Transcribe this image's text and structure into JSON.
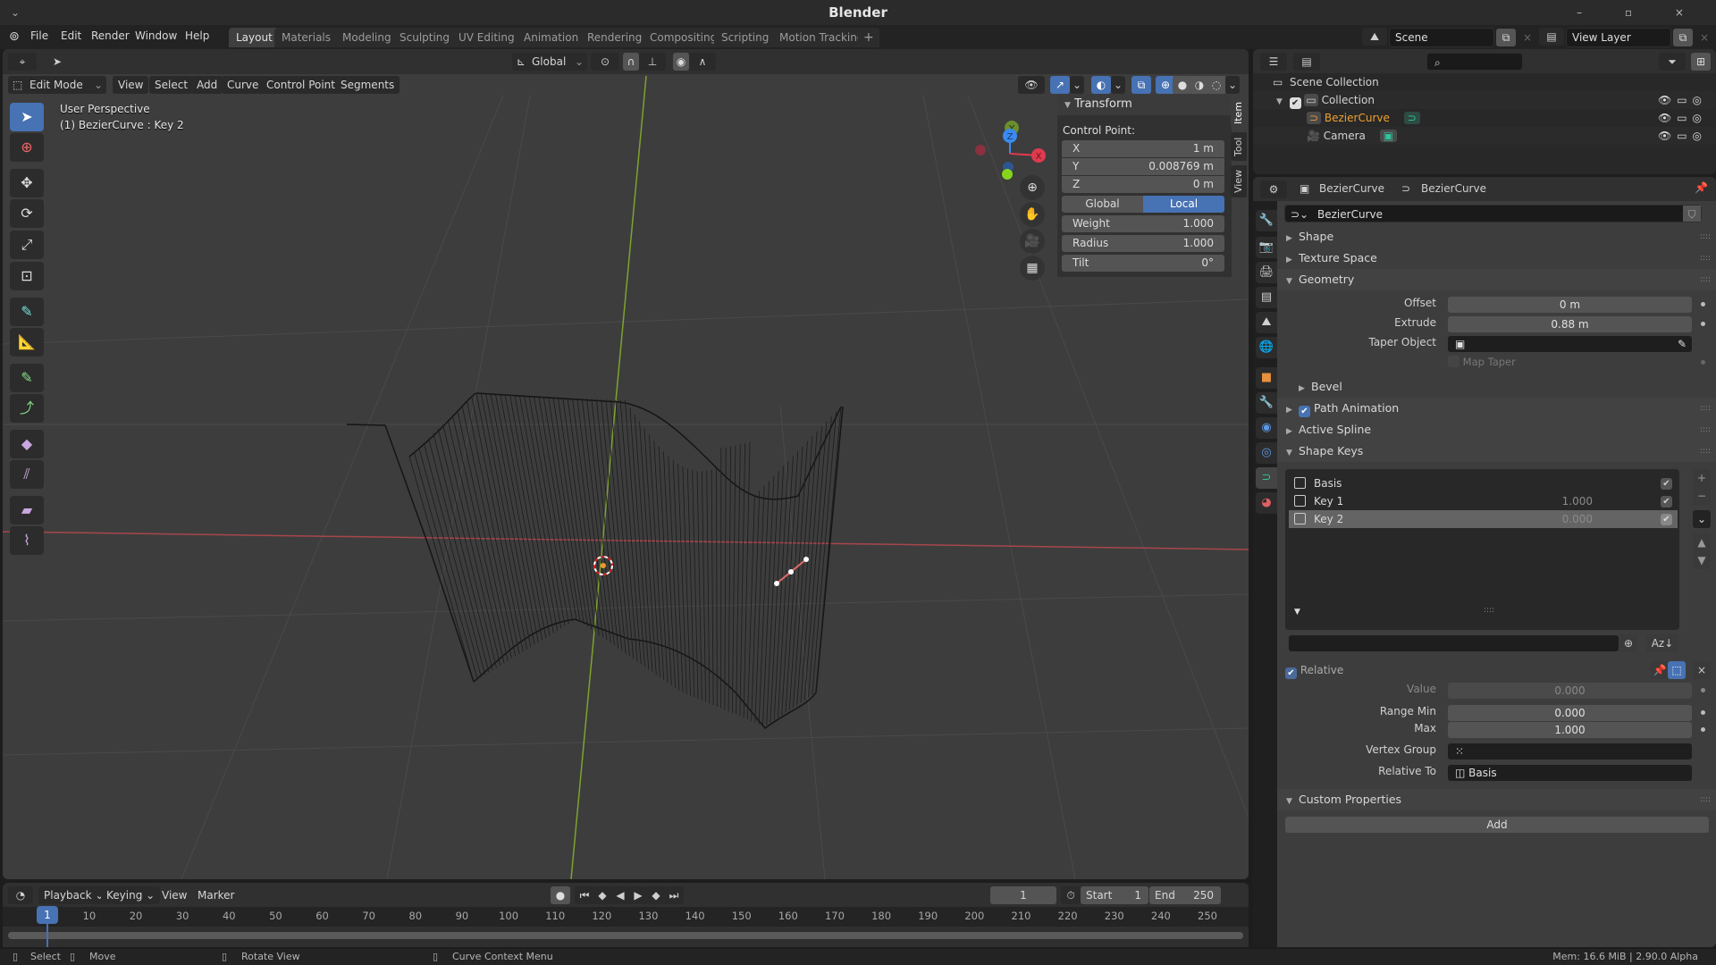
{
  "app_title": "Blender",
  "menu": [
    "File",
    "Edit",
    "Render",
    "Window",
    "Help"
  ],
  "workspaces": [
    {
      "label": "Layout",
      "active": true
    },
    {
      "label": "Materials"
    },
    {
      "label": "Modeling"
    },
    {
      "label": "Sculpting"
    },
    {
      "label": "UV Editing"
    },
    {
      "label": "Animation"
    },
    {
      "label": "Rendering"
    },
    {
      "label": "Compositing"
    },
    {
      "label": "Scripting"
    },
    {
      "label": "Motion Tracking"
    }
  ],
  "add_workspace": "+",
  "scene": {
    "name": "Scene",
    "view_layer": "View Layer"
  },
  "viewport": {
    "transform_orientation": "Global",
    "mode": "Edit Mode",
    "header_menus": [
      "View",
      "Select",
      "Add",
      "Curve",
      "Control Points",
      "Segments"
    ],
    "info_line1": "User Perspective",
    "info_line2": "(1) BezierCurve : Key 2",
    "gizmo_axes": {
      "x": "X",
      "y": "Y",
      "z": "Z"
    },
    "colors": {
      "x_axis": "#c8474f",
      "y_axis": "#7da32e",
      "z_axis": "#3a8bef"
    }
  },
  "npanel": {
    "tabs": [
      "Item",
      "Tool",
      "View"
    ],
    "active_tab": "Item",
    "title": "Transform",
    "section": "Control Point:",
    "x": {
      "label": "X",
      "value": "1 m"
    },
    "y": {
      "label": "Y",
      "value": "0.008769 m"
    },
    "z": {
      "label": "Z",
      "value": "0 m"
    },
    "space_global": "Global",
    "space_local": "Local",
    "active_space": "Local",
    "weight": {
      "label": "Weight",
      "value": "1.000"
    },
    "radius": {
      "label": "Radius",
      "value": "1.000"
    },
    "tilt": {
      "label": "Tilt",
      "value": "0°"
    }
  },
  "outliner": {
    "search_placeholder": "",
    "root": "Scene Collection",
    "items": [
      {
        "name": "Collection",
        "type": "collection"
      },
      {
        "name": "BezierCurve",
        "type": "curve",
        "selected": true
      },
      {
        "name": "Camera",
        "type": "camera"
      }
    ]
  },
  "properties": {
    "breadcrumb": [
      "BezierCurve",
      "BezierCurve"
    ],
    "datablock_name": "BezierCurve",
    "panels": {
      "shape": "Shape",
      "texture_space": "Texture Space",
      "geometry": "Geometry",
      "bevel": "Bevel",
      "path_animation": "Path Animation",
      "active_spline": "Active Spline",
      "shape_keys": "Shape Keys",
      "custom_properties": "Custom Properties"
    },
    "geometry": {
      "offset": {
        "label": "Offset",
        "value": "0 m"
      },
      "extrude": {
        "label": "Extrude",
        "value": "0.88 m"
      },
      "taper_object": {
        "label": "Taper Object",
        "value": ""
      },
      "map_taper": "Map Taper"
    },
    "path_animation_enabled": true,
    "shape_keys": [
      {
        "name": "Basis",
        "value": "",
        "enabled": true
      },
      {
        "name": "Key 1",
        "value": "1.000",
        "enabled": true
      },
      {
        "name": "Key 2",
        "value": "0.000",
        "enabled": true,
        "selected": true
      }
    ],
    "relative": {
      "label": "Relative",
      "checked": true
    },
    "value": {
      "label": "Value",
      "value": "0.000"
    },
    "range_min": {
      "label": "Range Min",
      "value": "0.000"
    },
    "max": {
      "label": "Max",
      "value": "1.000"
    },
    "vertex_group": {
      "label": "Vertex Group",
      "value": ""
    },
    "relative_to": {
      "label": "Relative To",
      "value": "Basis"
    },
    "add_button": "Add"
  },
  "timeline": {
    "menus": [
      "Playback",
      "Keying",
      "View",
      "Marker"
    ],
    "current_frame": "1",
    "start_label": "Start",
    "start": "1",
    "end_label": "End",
    "end": "250",
    "ticks": [
      "10",
      "20",
      "30",
      "40",
      "50",
      "60",
      "70",
      "80",
      "90",
      "100",
      "110",
      "120",
      "130",
      "140",
      "150",
      "160",
      "170",
      "180",
      "190",
      "200",
      "210",
      "220",
      "230",
      "240",
      "250"
    ],
    "playhead": "1"
  },
  "statusbar": {
    "select": "Select",
    "move": "Move",
    "rotate": "Rotate View",
    "context": "Curve Context Menu",
    "info": "Mem: 16.6 MiB | 2.90.0 Alpha"
  }
}
